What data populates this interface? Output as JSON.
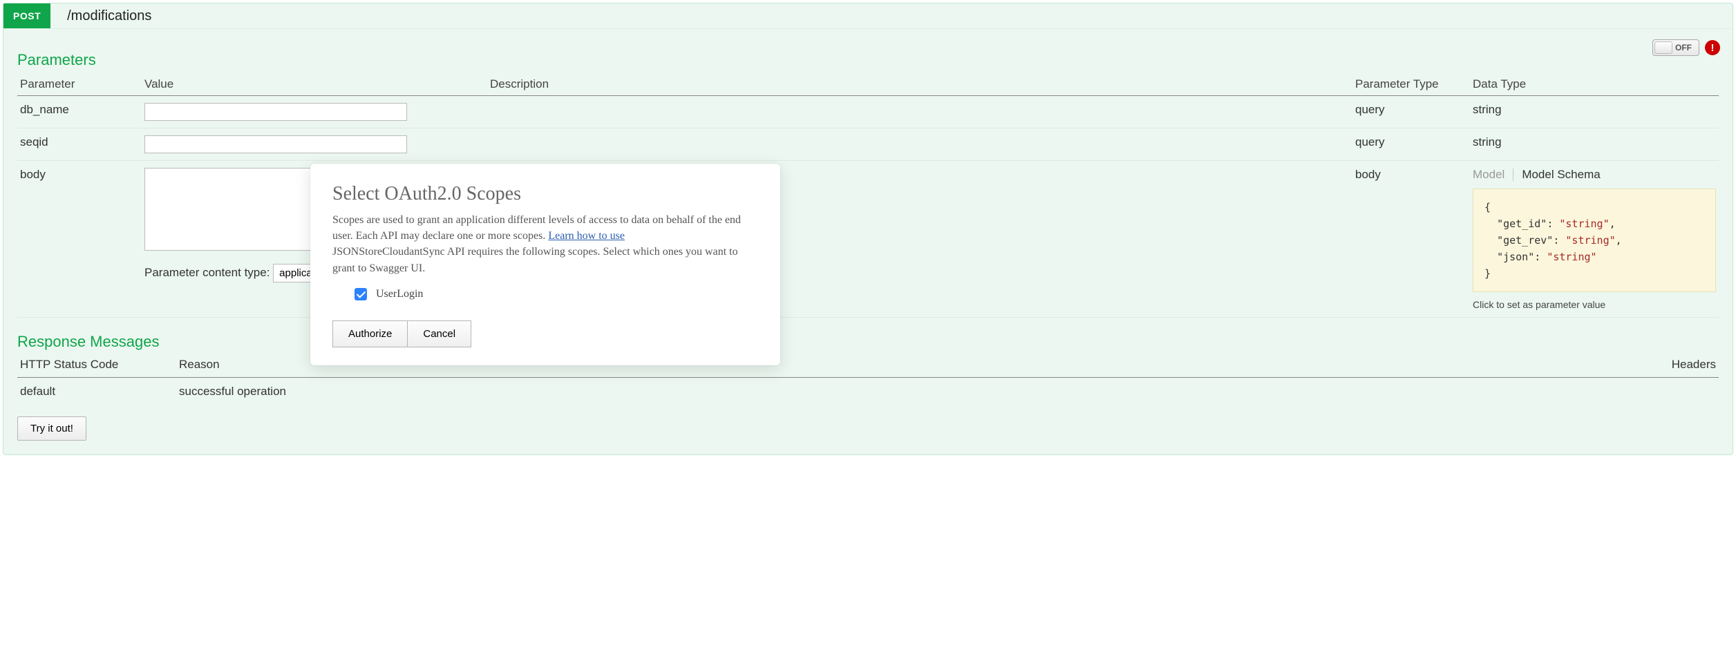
{
  "method_badge": "POST",
  "path": "/modifications",
  "toggle_label": "OFF",
  "parameters_title": "Parameters",
  "param_headers": {
    "parameter": "Parameter",
    "value": "Value",
    "description": "Description",
    "ptype": "Parameter Type",
    "dtype": "Data Type"
  },
  "params": [
    {
      "name": "db_name",
      "ptype": "query",
      "dtype": "string",
      "kind": "text"
    },
    {
      "name": "seqid",
      "ptype": "query",
      "dtype": "string",
      "kind": "text"
    },
    {
      "name": "body",
      "ptype": "body",
      "dtype": "",
      "kind": "body"
    }
  ],
  "content_type_label": "Parameter content type:",
  "content_type_options": [
    "application/json"
  ],
  "content_type_selected": "application/json",
  "model_tabs": {
    "model": "Model",
    "schema": "Model Schema"
  },
  "schema_preview": {
    "get_id": "string",
    "get_rev": "string",
    "json": "string"
  },
  "schema_hint": "Click to set as parameter value",
  "responses_title": "Response Messages",
  "response_headers": {
    "status": "HTTP Status Code",
    "reason": "Reason",
    "headers": "Headers"
  },
  "responses": [
    {
      "status": "default",
      "reason": "successful operation"
    }
  ],
  "try_button": "Try it out!",
  "dialog": {
    "title": "Select OAuth2.0 Scopes",
    "desc_part1": "Scopes are used to grant an application different levels of access to data on behalf of the end user. Each API may declare one or more scopes.",
    "learn_link": "Learn how to use",
    "desc_part2": "JSONStoreCloudantSync API requires the following scopes. Select which ones you want to grant to Swagger UI.",
    "scope_label": "UserLogin",
    "authorize": "Authorize",
    "cancel": "Cancel"
  }
}
